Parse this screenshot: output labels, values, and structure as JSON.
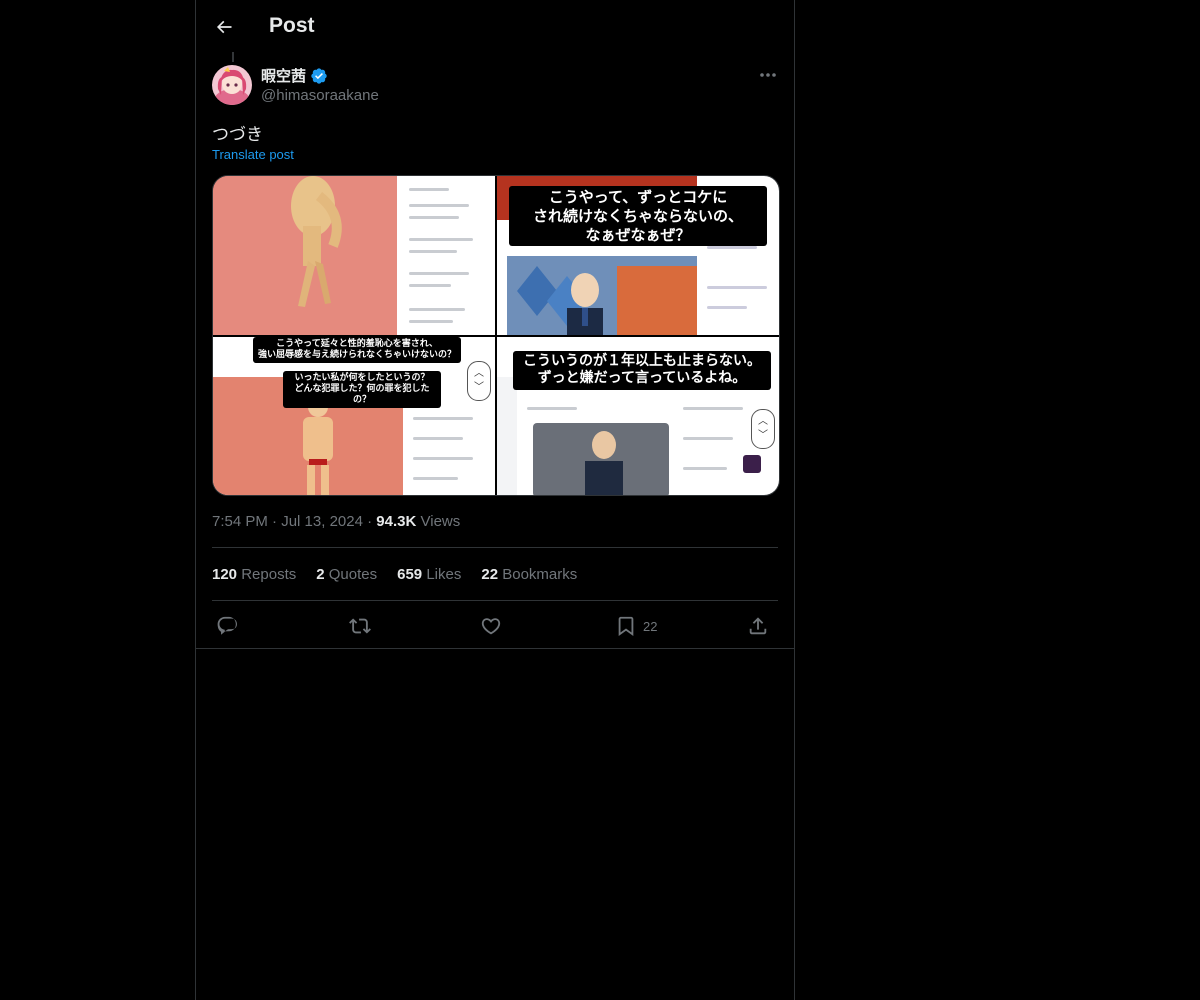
{
  "header": {
    "title": "Post"
  },
  "author": {
    "name": "暇空茜",
    "handle": "@himasoraakane",
    "verified": true
  },
  "post": {
    "text": "つづき",
    "translate_label": "Translate post",
    "time": "7:54 PM",
    "date": "Jul 13, 2024",
    "views_count": "94.3K",
    "views_label": "Views"
  },
  "media": {
    "captions": {
      "tile3_line1": "こうやって延々と性的羞恥心を害され、",
      "tile3_line2": "強い屈辱感を与え続けられなくちゃいけないの？",
      "tile3_line3": "いったい私が何をしたというの？",
      "tile3_line4": "どんな犯罪した？何の罪を犯したの？",
      "tile2_line1": "こうやって、ずっとコケに",
      "tile2_line2": "され続けなくちゃならないの、",
      "tile2_line3": "なぁぜなぁぜ？",
      "tile4_line1": "こういうのが１年以上も止まらない。",
      "tile4_line2": "ずっと嫌だって言っているよね。"
    }
  },
  "stats": {
    "reposts_count": "120",
    "reposts_label": "Reposts",
    "quotes_count": "2",
    "quotes_label": "Quotes",
    "likes_count": "659",
    "likes_label": "Likes",
    "bookmarks_count": "22",
    "bookmarks_label": "Bookmarks"
  },
  "actions": {
    "bookmark_count": "22"
  },
  "colors": {
    "background": "#000000",
    "text": "#e7e9ea",
    "muted": "#71767b",
    "accent": "#1d9bf0",
    "border": "#2f3336"
  },
  "icons": [
    "back-arrow-icon",
    "verified-badge-icon",
    "more-icon",
    "reply-icon",
    "repost-icon",
    "like-icon",
    "bookmark-icon",
    "share-icon"
  ]
}
